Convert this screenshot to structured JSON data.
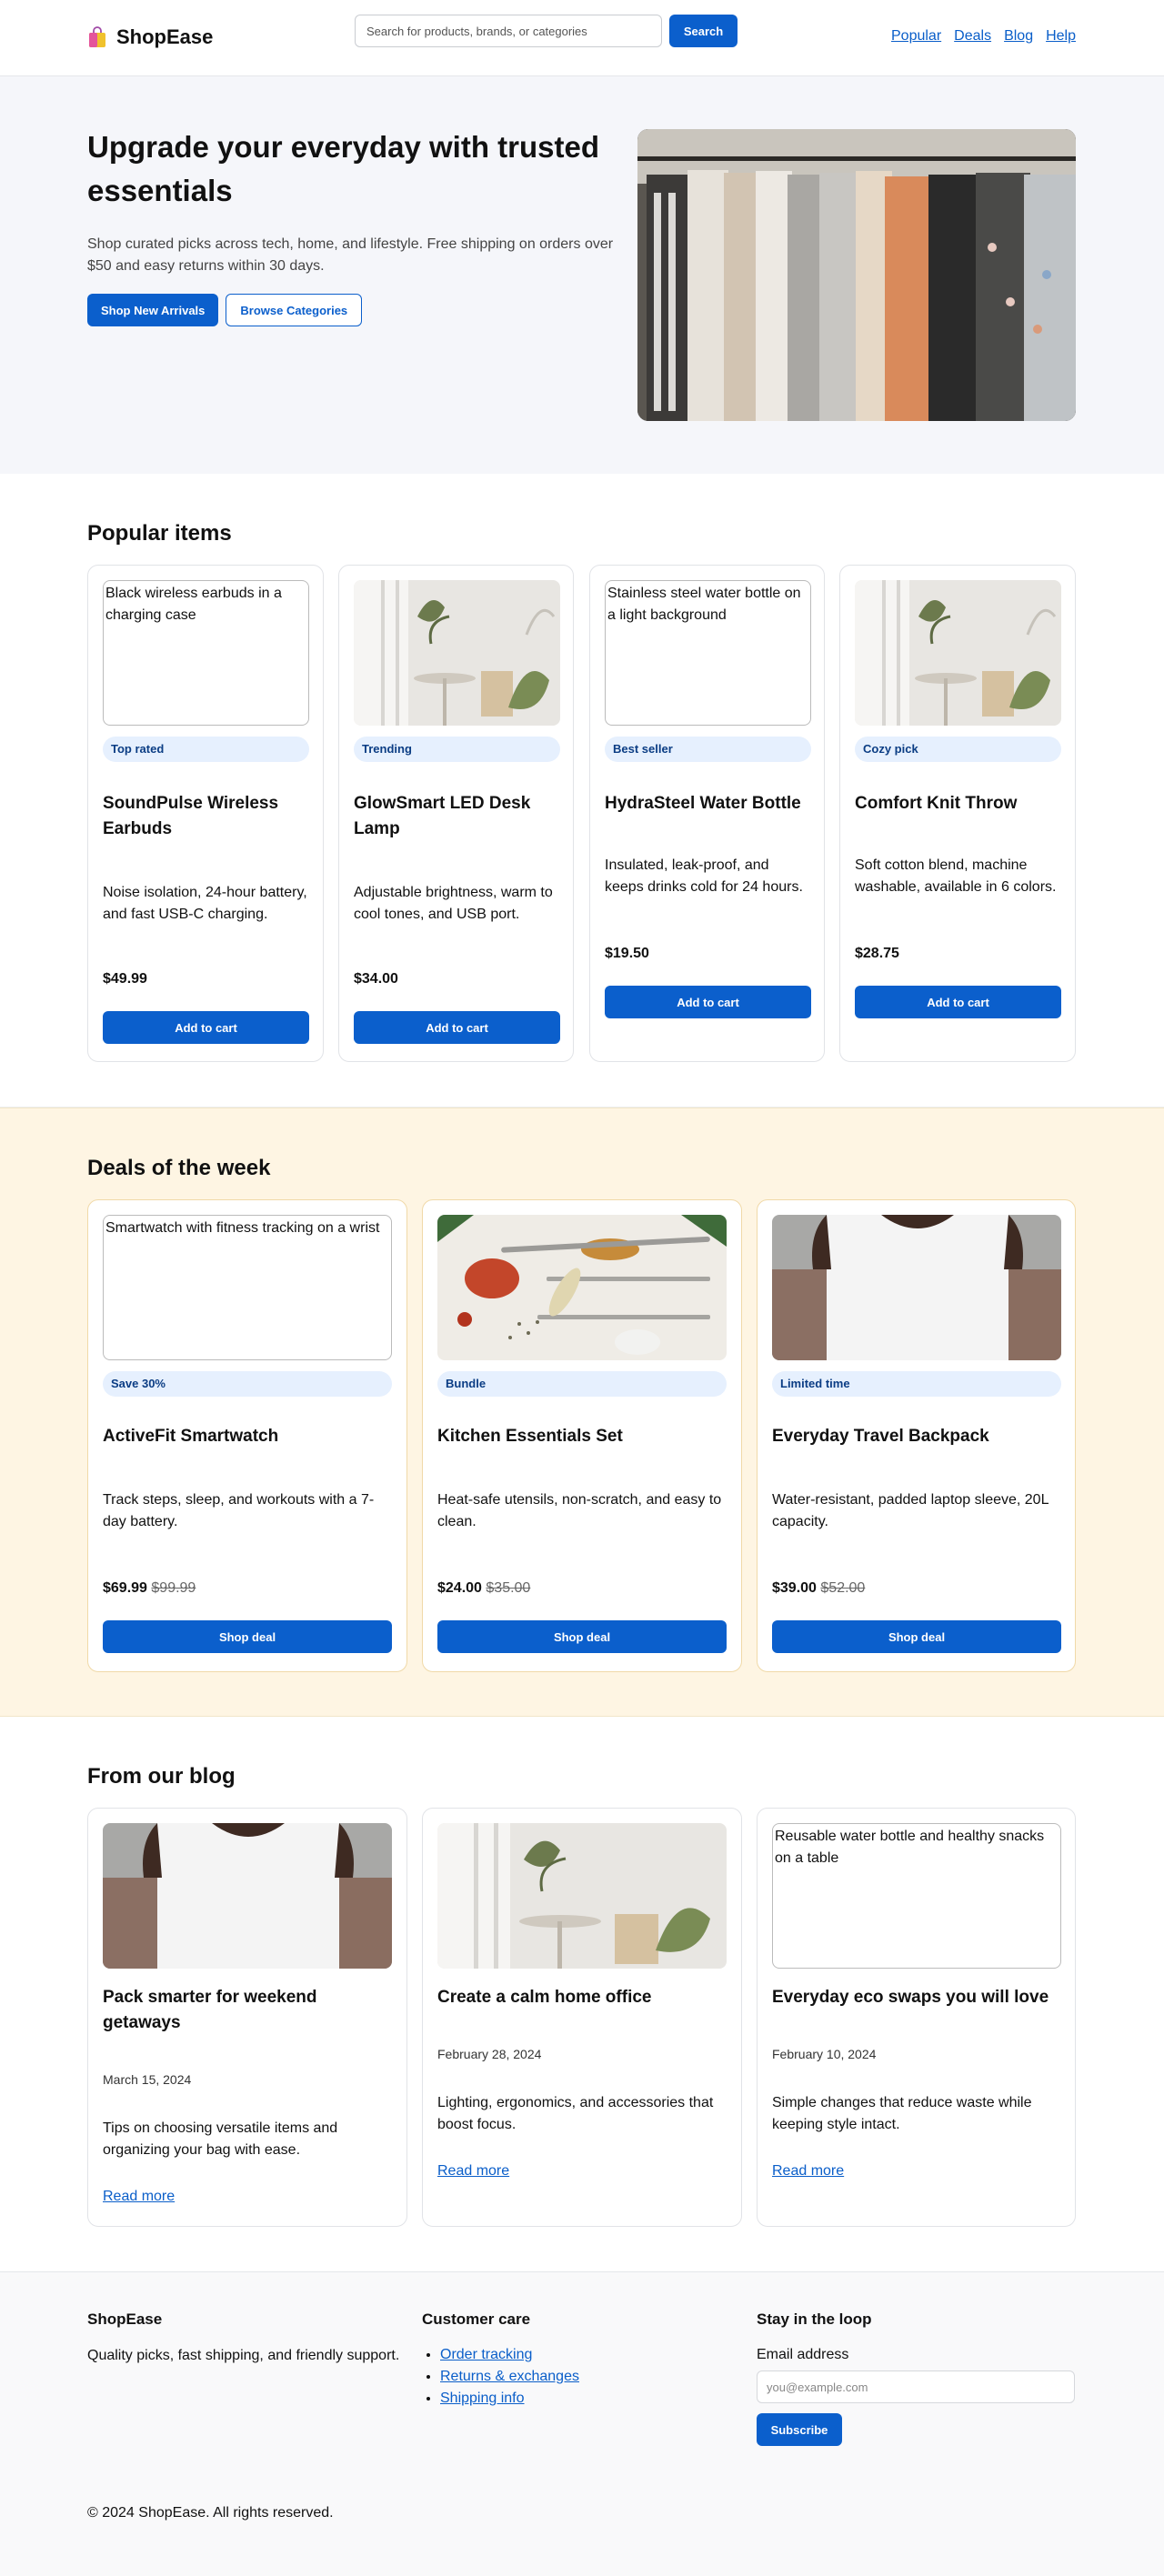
{
  "header": {
    "brand": "ShopEase",
    "search_placeholder": "Search for products, brands, or categories",
    "search_button": "Search",
    "nav": [
      "Popular",
      "Deals",
      "Blog",
      "Help"
    ]
  },
  "hero": {
    "title": "Upgrade your everyday with trusted essentials",
    "subtitle": "Shop curated picks across tech, home, and lifestyle. Free shipping on orders over $50 and easy returns within 30 days.",
    "primary_button": "Shop New Arrivals",
    "secondary_button": "Browse Categories"
  },
  "popular": {
    "title": "Popular items",
    "items": [
      {
        "alt": "Black wireless earbuds in a charging case",
        "badge": "Top rated",
        "name": "SoundPulse Wireless Earbuds",
        "desc": "Noise isolation, 24-hour battery, and fast USB-C charging.",
        "price": "$49.99",
        "button": "Add to cart"
      },
      {
        "alt": "",
        "badge": "Trending",
        "name": "GlowSmart LED Desk Lamp",
        "desc": "Adjustable brightness, warm to cool tones, and USB port.",
        "price": "$34.00",
        "button": "Add to cart"
      },
      {
        "alt": "Stainless steel water bottle on a light background",
        "badge": "Best seller",
        "name": "HydraSteel Water Bottle",
        "desc": "Insulated, leak-proof, and keeps drinks cold for 24 hours.",
        "price": "$19.50",
        "button": "Add to cart"
      },
      {
        "alt": "",
        "badge": "Cozy pick",
        "name": "Comfort Knit Throw",
        "desc": "Soft cotton blend, machine washable, available in 6 colors.",
        "price": "$28.75",
        "button": "Add to cart"
      }
    ]
  },
  "deals": {
    "title": "Deals of the week",
    "items": [
      {
        "alt": "Smartwatch with fitness tracking on a wrist",
        "badge": "Save 30%",
        "name": "ActiveFit Smartwatch",
        "desc": "Track steps, sleep, and workouts with a 7-day battery.",
        "price": "$69.99",
        "old_price": "$99.99",
        "button": "Shop deal"
      },
      {
        "alt": "",
        "badge": "Bundle",
        "name": "Kitchen Essentials Set",
        "desc": "Heat-safe utensils, non-scratch, and easy to clean.",
        "price": "$24.00",
        "old_price": "$35.00",
        "button": "Shop deal"
      },
      {
        "alt": "",
        "badge": "Limited time",
        "name": "Everyday Travel Backpack",
        "desc": "Water-resistant, padded laptop sleeve, 20L capacity.",
        "price": "$39.00",
        "old_price": "$52.00",
        "button": "Shop deal"
      }
    ]
  },
  "blog": {
    "title": "From our blog",
    "posts": [
      {
        "alt": "",
        "title": "Pack smarter for weekend getaways",
        "date": "March 15, 2024",
        "desc": "Tips on choosing versatile items and organizing your bag with ease.",
        "link": "Read more"
      },
      {
        "alt": "",
        "title": "Create a calm home office",
        "date": "February 28, 2024",
        "desc": "Lighting, ergonomics, and accessories that boost focus.",
        "link": "Read more"
      },
      {
        "alt": "Reusable water bottle and healthy snacks on a table",
        "title": "Everyday eco swaps you will love",
        "date": "February 10, 2024",
        "desc": "Simple changes that reduce waste while keeping style intact.",
        "link": "Read more"
      }
    ]
  },
  "footer": {
    "brand": "ShopEase",
    "tagline": "Quality picks, fast shipping, and friendly support.",
    "care_title": "Customer care",
    "care_links": [
      "Order tracking",
      "Returns & exchanges",
      "Shipping info"
    ],
    "newsletter_title": "Stay in the loop",
    "email_label": "Email address",
    "email_placeholder": "you@example.com",
    "subscribe": "Subscribe",
    "copyright": "© 2024 ShopEase. All rights reserved."
  }
}
